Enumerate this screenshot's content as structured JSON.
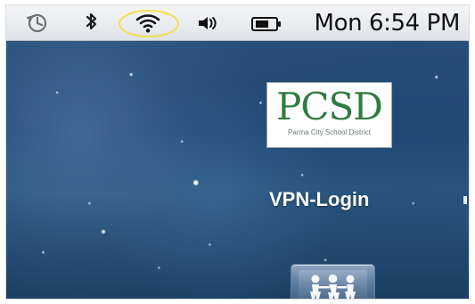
{
  "menubar": {
    "items": [
      {
        "name": "time-machine-icon",
        "label": "Time Machine"
      },
      {
        "name": "bluetooth-icon",
        "label": "Bluetooth"
      },
      {
        "name": "wifi-icon",
        "label": "Wi-Fi"
      },
      {
        "name": "volume-icon",
        "label": "Volume"
      },
      {
        "name": "battery-icon",
        "label": "Battery"
      }
    ],
    "clock": "Mon 6:54 PM"
  },
  "desktop": {
    "logo": {
      "mark": "PCSD",
      "subtext": "Parma City School District"
    },
    "vpn_label": "VPN-Login",
    "app_icon_name": "family-group-icon"
  },
  "colors": {
    "menubar_bg": "#e8ebee",
    "highlight": "#f4e14d",
    "logo_green": "#2f7b40",
    "desktop_blue": "#214875"
  }
}
